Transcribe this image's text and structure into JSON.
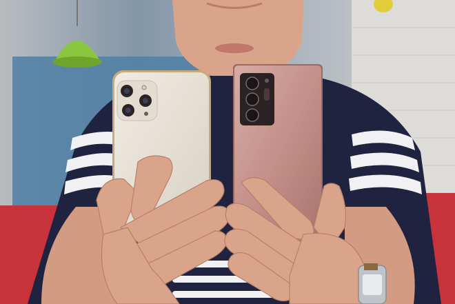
{
  "palette": {
    "wall_left": "#c9c9c4",
    "wall_blue": "#4f7fa6",
    "wall_right": "#d8d6d2",
    "lamp_green": "#8bc63f",
    "sofa_red": "#c8323a",
    "skin": "#d9a48a",
    "skin_shadow": "#b77f68",
    "shirt_navy": "#1f2340",
    "shirt_stripe": "#f1f1f3",
    "phone_white": "#e7e1d6",
    "phone_bronze": "#c99d95",
    "camera_dark": "#2b2224",
    "watch_silver": "#bfc4c8"
  }
}
